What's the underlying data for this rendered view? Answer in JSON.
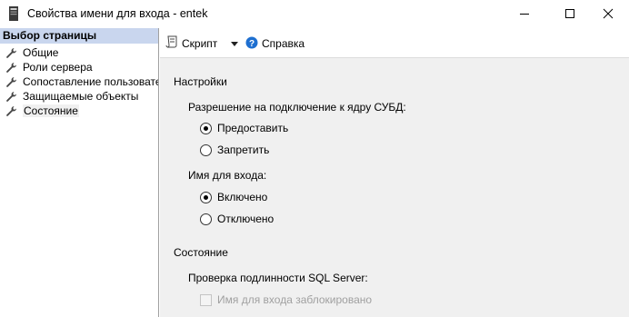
{
  "window": {
    "title": "Свойства имени для входа - entek",
    "app_icon": "sql-server-icon",
    "controls": [
      "minimize-icon",
      "maximize-icon",
      "close-icon"
    ]
  },
  "sidebar": {
    "header": "Выбор страницы",
    "items": [
      {
        "label": "Общие",
        "icon": "wrench-icon"
      },
      {
        "label": "Роли сервера",
        "icon": "wrench-icon"
      },
      {
        "label": "Сопоставление пользователей",
        "icon": "wrench-icon"
      },
      {
        "label": "Защищаемые объекты",
        "icon": "wrench-icon"
      },
      {
        "label": "Состояние",
        "icon": "wrench-icon",
        "selected": true
      }
    ]
  },
  "toolbar": {
    "script_label": "Скрипт",
    "help_label": "Справка"
  },
  "settings": {
    "section_title": "Настройки",
    "db_engine_label": "Разрешение на подключение к ядру СУБД:",
    "grant_label": "Предоставить",
    "deny_label": "Запретить",
    "db_engine_value": "Предоставить",
    "login_label": "Имя для входа:",
    "enabled_label": "Включено",
    "disabled_label": "Отключено",
    "login_value": "Включено"
  },
  "status": {
    "section_title": "Состояние",
    "auth_label": "Проверка подлинности SQL Server:",
    "locked_label": "Имя для входа заблокировано",
    "locked_checked": false,
    "locked_enabled": false
  },
  "colors": {
    "sidebar_header_bg": "#c9d6ee",
    "panel_bg": "#f0f0f0",
    "help_icon": "#1e6fd0",
    "disabled_text": "#a0a0a0"
  }
}
